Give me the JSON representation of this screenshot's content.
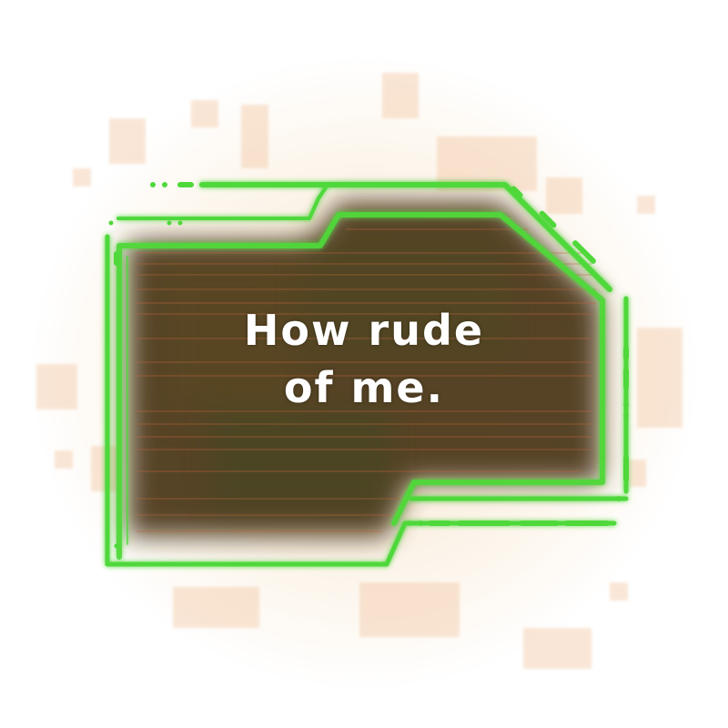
{
  "dialog": {
    "line1": "How rude",
    "line2": "of me."
  },
  "colors": {
    "frame_green": "#4fd83a",
    "panel_dark": "#4a3518",
    "scanline": "#c0653a",
    "glow": "#f3c9a6",
    "text": "#ffffff"
  },
  "icons": {
    "frame": "sci-fi-hud-frame"
  }
}
